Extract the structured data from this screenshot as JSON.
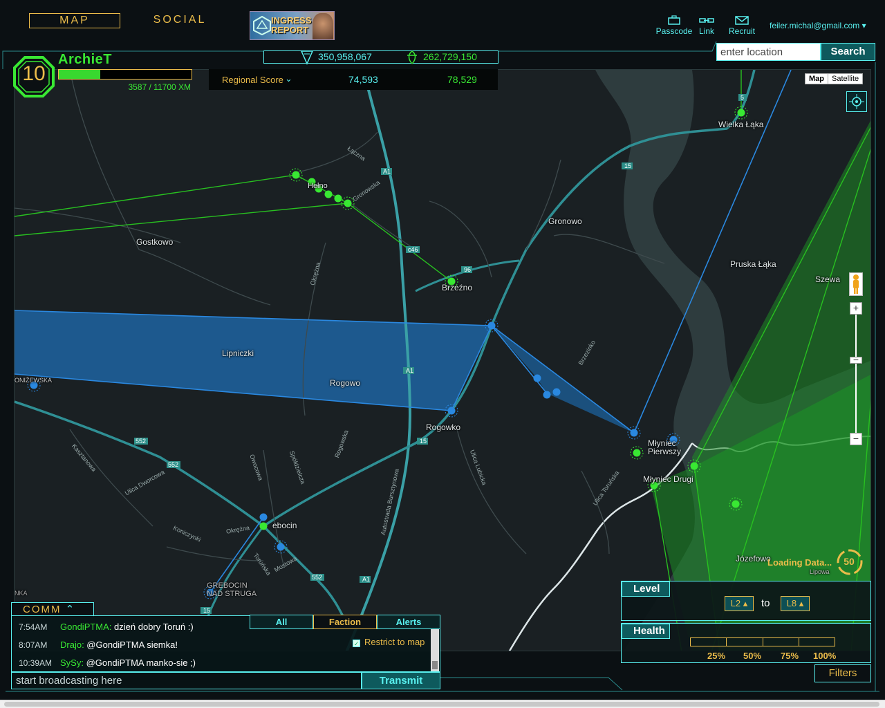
{
  "nav": {
    "map": "MAP",
    "social": "SOCIAL",
    "report_line1": "INGRESS",
    "report_line2": "REPORT"
  },
  "tools": {
    "passcode": "Passcode",
    "link": "Link",
    "recruit": "Recruit"
  },
  "user": {
    "email": "feiler.michal@gmail.com"
  },
  "global_score": {
    "resistance": "350,958,067",
    "enlightened": "262,729,150"
  },
  "search": {
    "placeholder": "enter location",
    "button": "Search"
  },
  "agent": {
    "name": "ArchieT",
    "level": "10",
    "xp": "3587 / 11700 XM",
    "xp_fraction": 0.31
  },
  "regional": {
    "label": "Regional Score",
    "resistance": "74,593",
    "enlightened": "78,529"
  },
  "map_type": {
    "map": "Map",
    "satellite": "Satellite"
  },
  "places": {
    "wielka_laka": "Wielka Łąka",
    "gronowo": "Gronowo",
    "pruska_laka": "Pruska Łąka",
    "szewa": "Szewa",
    "gostkowo": "Gostkowo",
    "brzezno": "Brzeźno",
    "lipniczki": "Lipniczki",
    "rogowo": "Rogowo",
    "rogowko": "Rogowko",
    "mlyniec_pierwszy_1": "Młyniec",
    "mlyniec_pierwszy_2": "Pierwszy",
    "mlyniec_drugi": "Młyniec Drugi",
    "grebocin": "ebocin",
    "grebocin_struga_1": "GREBOCIN",
    "grebocin_struga_2": "NAD STRUGA",
    "jozefowo": "Józefowo",
    "lipowa": "Lipowa",
    "onizewska": "ONIŻEWSKA",
    "nka": "NKA",
    "hel": "Hełno"
  },
  "roads": {
    "laczna": "Łączna",
    "gronowska": "Gronowska",
    "okrezna": "Okrężna",
    "brzezinko": "Brzezinko",
    "kasztanowa": "Kasztanowa",
    "dworcowa": "Ulica Dworcowa",
    "owocowa": "Owocowa",
    "spoldzielcza": "Spółdzielcza",
    "rogowska": "Rogowska",
    "lubicka": "Ulica Lubicka",
    "torunska": "Ulica Toruńska",
    "bursztynowa": "Autostrada Bursztynowa",
    "koniczynki": "Koniczynki",
    "okrezna2": "Okrężna",
    "torunska2": "Toruńska",
    "mostowa": "Mostowa",
    "s_a1": "A1",
    "s_15": "15",
    "s_c46": "c46",
    "s_96": "96",
    "s_552": "552",
    "s_5": "5"
  },
  "comm": {
    "title": "COMM",
    "tabs": [
      "All",
      "Faction",
      "Alerts"
    ],
    "restrict": "Restrict to map",
    "messages": [
      {
        "time": "7:54AM",
        "who": "GondiPTMA:",
        "text": " dzień dobry Toruń :)"
      },
      {
        "time": "8:07AM",
        "who": "Drajo:",
        "text": " @GondiPTMA siemka!"
      },
      {
        "time": "10:39AM",
        "who": "SySy:",
        "text": " @GondiPTMA manko-sie ;)"
      }
    ],
    "broadcast_placeholder": "start broadcasting here",
    "transmit": "Transmit"
  },
  "filters": {
    "level_label": "Level",
    "level_from": "L2",
    "to": "to",
    "level_to": "L8",
    "health_label": "Health",
    "h25": "25%",
    "h50": "50%",
    "h75": "75%",
    "h100": "100%",
    "filters_button": "Filters"
  },
  "loading": {
    "text": "Loading Data...",
    "count": "50"
  },
  "colors": {
    "cyan": "#59f0ef",
    "gold": "#ebbc4a",
    "enlightened": "#39e833",
    "resistance": "#1e88e5"
  }
}
